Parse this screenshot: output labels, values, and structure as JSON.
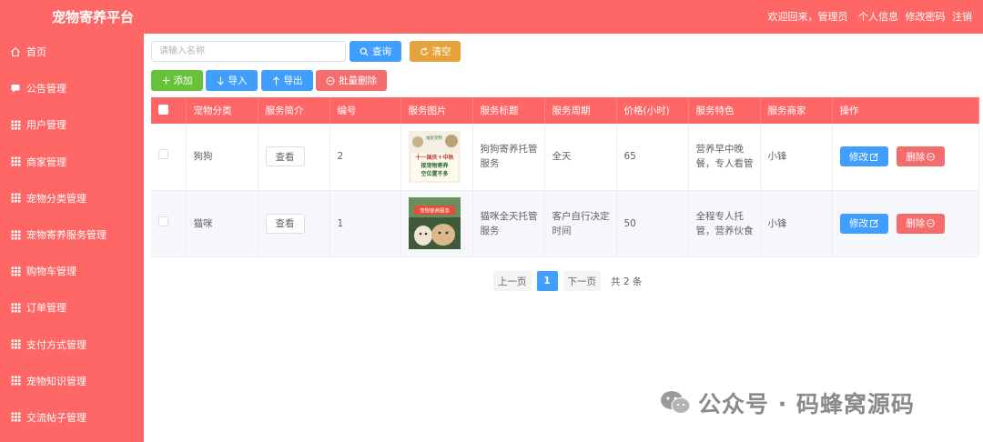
{
  "header": {
    "app_title": "宠物寄养平台",
    "welcome": "欢迎回来，管理员",
    "profile": "个人信息",
    "change_password": "修改密码",
    "logout": "注销"
  },
  "sidebar": {
    "items": [
      {
        "label": "首页",
        "icon": "home-icon"
      },
      {
        "label": "公告管理",
        "icon": "message-icon"
      },
      {
        "label": "用户管理",
        "icon": "grid-icon"
      },
      {
        "label": "商家管理",
        "icon": "grid-icon"
      },
      {
        "label": "宠物分类管理",
        "icon": "grid-icon"
      },
      {
        "label": "宠物寄养服务管理",
        "icon": "grid-icon"
      },
      {
        "label": "购物车管理",
        "icon": "grid-icon"
      },
      {
        "label": "订单管理",
        "icon": "grid-icon"
      },
      {
        "label": "支付方式管理",
        "icon": "grid-icon"
      },
      {
        "label": "宠物知识管理",
        "icon": "grid-icon"
      },
      {
        "label": "交流帖子管理",
        "icon": "grid-icon"
      }
    ]
  },
  "search": {
    "placeholder": "请输入名称",
    "query_label": "查询",
    "clear_label": "清空"
  },
  "toolbar": {
    "add_label": "添加",
    "import_label": "导入",
    "export_label": "导出",
    "batch_delete_label": "批量删除"
  },
  "table": {
    "columns": [
      "宠物分类",
      "服务简介",
      "编号",
      "服务图片",
      "服务标题",
      "服务周期",
      "价格(小时)",
      "服务特色",
      "服务商家",
      "操作"
    ],
    "view_label": "查看",
    "edit_label": "修改",
    "delete_label": "删除",
    "rows": [
      {
        "category": "狗狗",
        "number": "2",
        "title": "狗狗寄养托管服务",
        "cycle": "全天",
        "price": "65",
        "feature": "营养早中晚餐，专人看管",
        "merchant": "小锋",
        "image_text": "十一国庆＋中秋\n接宠物寄养\n空位置不多",
        "image_caption": "福星宠物"
      },
      {
        "category": "猫咪",
        "number": "1",
        "title": "猫咪全天托管服务",
        "cycle": "客户自行决定时间",
        "price": "50",
        "feature": "全程专人托管，营养伙食",
        "merchant": "小锋",
        "image_text": "宠物寄养服务",
        "image_caption": ""
      }
    ]
  },
  "pagination": {
    "prev_label": "上一页",
    "current_page": "1",
    "next_label": "下一页",
    "total_label": "共 2 条"
  },
  "watermark": {
    "text": "公众号 · 码蜂窝源码"
  },
  "colors": {
    "brand": "#ff6666",
    "primary": "#409eff",
    "warning": "#e6a23c",
    "success": "#67c23a",
    "danger": "#f56c6c"
  }
}
